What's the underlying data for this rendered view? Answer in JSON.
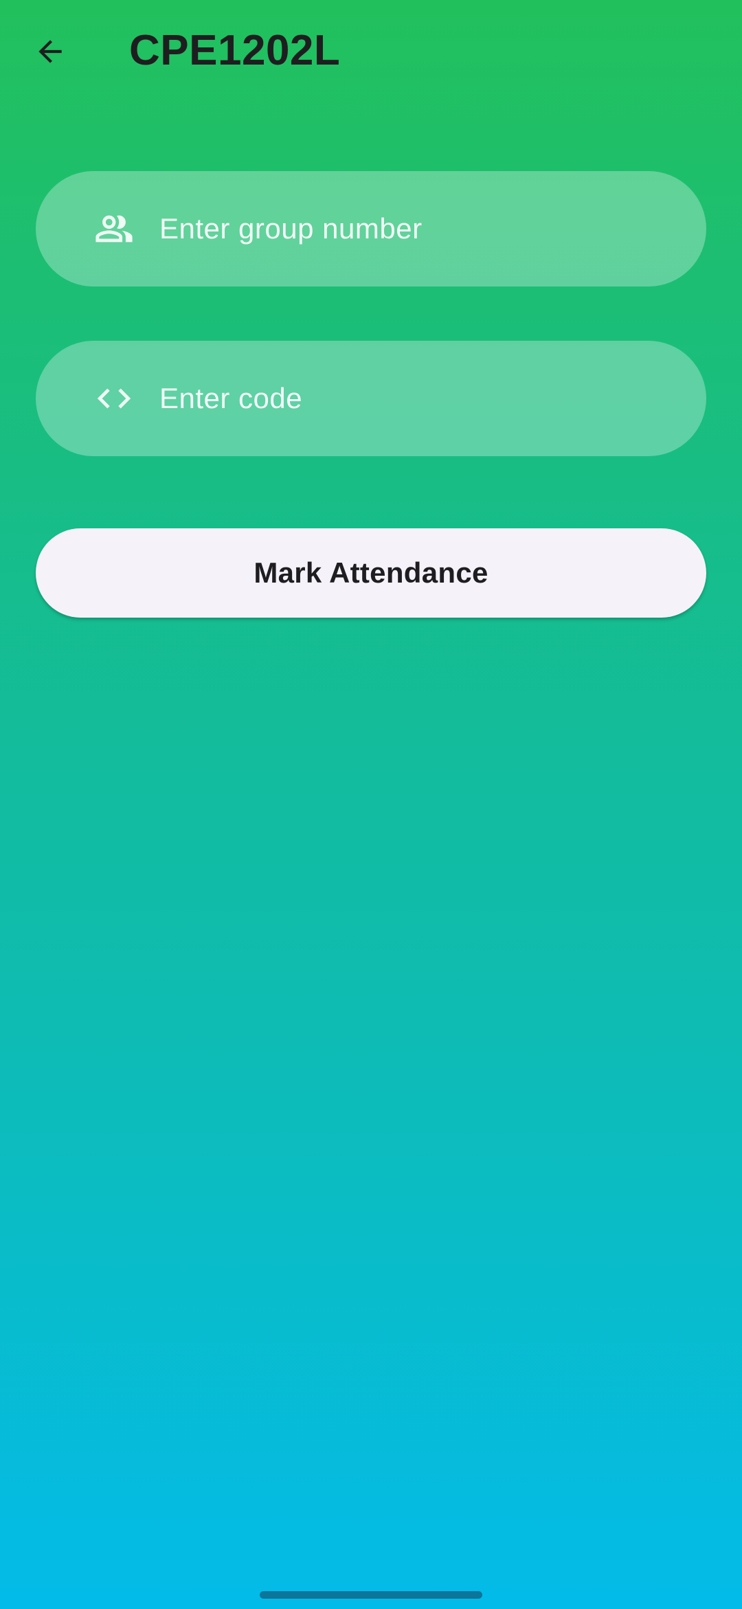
{
  "appbar": {
    "title": "CPE1202L",
    "back_icon": "arrow-left-icon"
  },
  "form": {
    "group_field": {
      "icon": "people-icon",
      "placeholder": "Enter group number",
      "value": ""
    },
    "code_field": {
      "icon": "code-icon",
      "placeholder": "Enter code",
      "value": ""
    },
    "submit_label": "Mark Attendance"
  },
  "colors": {
    "gradient_top": "#22c05c",
    "gradient_bottom": "#03bbe9",
    "field_background": "rgba(255,255,255,0.3)",
    "button_background": "#f6f2fa",
    "text_dark": "#1e1e20"
  }
}
